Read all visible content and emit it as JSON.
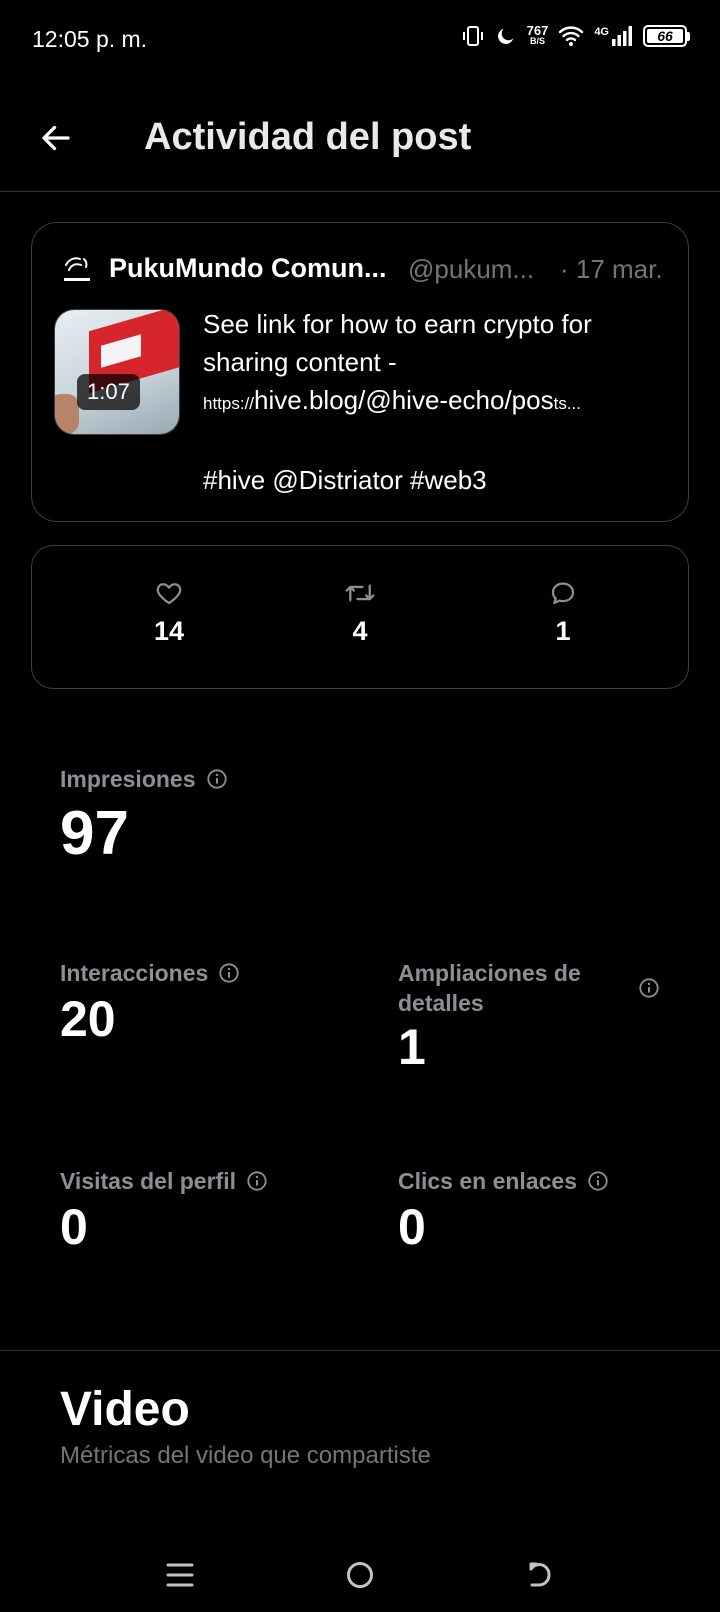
{
  "status_bar": {
    "time": "12:05 p. m.",
    "speed_value": "767",
    "speed_unit": "B/S",
    "network": "4G",
    "battery": "66"
  },
  "header": {
    "title": "Actividad del post"
  },
  "post": {
    "author_name": "PukuMundo Comun...",
    "author_handle": "@pukum...",
    "date": "· 17 mar.",
    "video_duration": "1:07",
    "text_line1": "See link for how to earn crypto for",
    "text_line2": "sharing content -",
    "link_prefix": "https://",
    "link_main": "hive.blog/@hive-echo/pos",
    "link_suffix": "ts...",
    "hashtags": "#hive @Distriator #web3"
  },
  "engagement": {
    "likes": "14",
    "reposts": "4",
    "replies": "1"
  },
  "metrics": {
    "impressions_label": "Impresiones",
    "impressions_value": "97",
    "interactions_label": "Interacciones",
    "interactions_value": "20",
    "detail_expands_label_line1": "Ampliaciones de",
    "detail_expands_label_line2": "detalles",
    "detail_expands_value": "1",
    "profile_visits_label": "Visitas del perfil",
    "profile_visits_value": "0",
    "link_clicks_label": "Clics en enlaces",
    "link_clicks_value": "0"
  },
  "video_section": {
    "title": "Video",
    "subtitle": "Métricas del video que compartiste"
  },
  "colors": {
    "background": "#000000",
    "text_primary": "#e7e9ea",
    "text_secondary": "#71767b",
    "border": "#2f3336"
  }
}
